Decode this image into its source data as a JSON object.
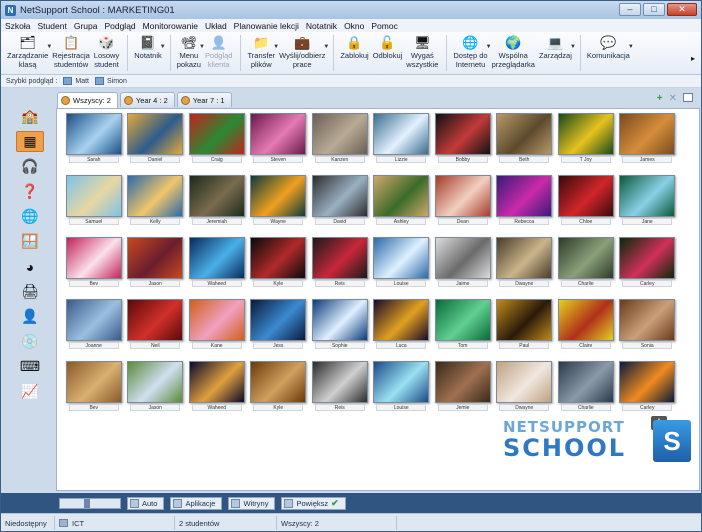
{
  "window": {
    "title": "NetSupport School : MARKETING01"
  },
  "menu": [
    "Szkoła",
    "Student",
    "Grupa",
    "Podgląd",
    "Monitorowanie",
    "Układ",
    "Planowanie lekcji",
    "Notatnik",
    "Okno",
    "Pomoc"
  ],
  "toolbar": [
    {
      "label": "Zarządzanie\nklasą",
      "icon": "class-management-icon",
      "glyph": "🗂",
      "disabled": false,
      "arrow": true
    },
    {
      "label": "Rejestracja\nstudentów",
      "icon": "register-icon",
      "glyph": "📋",
      "disabled": false,
      "arrow": false
    },
    {
      "label": "Losowy\nstudent",
      "icon": "dice-icon",
      "glyph": "🎲",
      "disabled": false,
      "arrow": false
    },
    {
      "label": "Notatnik",
      "icon": "notebook-icon",
      "glyph": "📓",
      "disabled": false,
      "arrow": true
    },
    {
      "label": "Menu\npokazu",
      "icon": "show-icon",
      "glyph": "📽",
      "disabled": false,
      "arrow": true
    },
    {
      "label": "Podgląd\nklienta",
      "icon": "view-client-icon",
      "glyph": "👤",
      "disabled": true,
      "arrow": false
    },
    {
      "label": "Transfer\nplików",
      "icon": "file-transfer-icon",
      "glyph": "📁",
      "disabled": false,
      "arrow": true
    },
    {
      "label": "Wyślij/odbierz\nprace",
      "icon": "briefcase-icon",
      "glyph": "💼",
      "disabled": false,
      "arrow": true
    },
    {
      "label": "Zablokuj",
      "icon": "lock-icon",
      "glyph": "🔒",
      "disabled": false,
      "arrow": false
    },
    {
      "label": "Odblokuj",
      "icon": "unlock-icon",
      "glyph": "🔓",
      "disabled": false,
      "arrow": false
    },
    {
      "label": "Wygaś\nwszystkie",
      "icon": "monitor-icon",
      "glyph": "🖥",
      "disabled": false,
      "arrow": false
    },
    {
      "label": "Dostęp do\nInternetu",
      "icon": "internet-icon",
      "glyph": "🌐",
      "disabled": false,
      "arrow": true
    },
    {
      "label": "Wspólna\nprzeglądarka",
      "icon": "globe-icon",
      "glyph": "🌍",
      "disabled": false,
      "arrow": false
    },
    {
      "label": "Zarządzaj",
      "icon": "manage-icon",
      "glyph": "💻",
      "disabled": false,
      "arrow": true
    },
    {
      "label": "Komunikacja",
      "icon": "chat-icon",
      "glyph": "💬",
      "disabled": false,
      "arrow": true
    }
  ],
  "quickview": {
    "label": "Szybki podgląd :",
    "items": [
      "Matt",
      "Simon"
    ]
  },
  "tabs": [
    {
      "label": "Wszyscy: 2",
      "active": true
    },
    {
      "label": "Year 4 : 2",
      "active": false
    },
    {
      "label": "Year 7 : 1",
      "active": false
    }
  ],
  "sidebar": [
    {
      "icon": "classroom-icon",
      "glyph": "🏫",
      "active": false
    },
    {
      "icon": "thumbnail-view-icon",
      "glyph": "▦",
      "active": true
    },
    {
      "icon": "headphones-icon",
      "glyph": "🎧",
      "active": false
    },
    {
      "icon": "question-icon",
      "glyph": "❓",
      "active": false
    },
    {
      "icon": "internet-icon",
      "glyph": "🌐",
      "active": false
    },
    {
      "icon": "applications-icon",
      "glyph": "🪟",
      "active": false
    },
    {
      "icon": "pie-chart-icon",
      "glyph": "◕",
      "active": false
    },
    {
      "icon": "printer-icon",
      "glyph": "🖨",
      "active": false
    },
    {
      "icon": "user-icon",
      "glyph": "👤",
      "active": false
    },
    {
      "icon": "cd-icon",
      "glyph": "💿",
      "active": false
    },
    {
      "icon": "keyboard-icon",
      "glyph": "⌨",
      "active": false
    },
    {
      "icon": "chart-icon",
      "glyph": "📈",
      "active": false
    }
  ],
  "students": [
    {
      "name": "Sarah",
      "c1": "#1b4f86",
      "c2": "#a8d2f0"
    },
    {
      "name": "Daniel",
      "c1": "#e3a83b",
      "c2": "#2d5b8c"
    },
    {
      "name": "Craig",
      "c1": "#c0241e",
      "c2": "#2a8a34"
    },
    {
      "name": "Steven",
      "c1": "#6a1a4a",
      "c2": "#e57ab5"
    },
    {
      "name": "Kanzen",
      "c1": "#6a6053",
      "c2": "#b8aa95"
    },
    {
      "name": "Lizzie",
      "c1": "#3a6d8f",
      "c2": "#e4f1ff"
    },
    {
      "name": "Bobby",
      "c1": "#111111",
      "c2": "#c33a3a"
    },
    {
      "name": "Beth",
      "c1": "#b89868",
      "c2": "#5c4a2d"
    },
    {
      "name": "T Joy",
      "c1": "#1a4a1a",
      "c2": "#e6c21f"
    },
    {
      "name": "James",
      "c1": "#7a4b1f",
      "c2": "#d68d3a"
    },
    {
      "name": "Samuel",
      "c1": "#7ec3e8",
      "c2": "#e8d7a2"
    },
    {
      "name": "Kelly",
      "c1": "#2b6aa8",
      "c2": "#f0c66b"
    },
    {
      "name": "Jeremiah",
      "c1": "#1d2a1d",
      "c2": "#7a6b4d"
    },
    {
      "name": "Wayne",
      "c1": "#0f3b3b",
      "c2": "#f0a020"
    },
    {
      "name": "David",
      "c1": "#2d2d2d",
      "c2": "#9ab0c2"
    },
    {
      "name": "Ashley",
      "c1": "#cfa86a",
      "c2": "#3a6b2a"
    },
    {
      "name": "Dean",
      "c1": "#a63a2a",
      "c2": "#f1d0c0"
    },
    {
      "name": "Rebecca",
      "c1": "#3a1a7a",
      "c2": "#c92aa8"
    },
    {
      "name": "Chloe",
      "c1": "#3a0a0a",
      "c2": "#d0252a"
    },
    {
      "name": "Jane",
      "c1": "#0a5a3a",
      "c2": "#8ad0e8"
    },
    {
      "name": "Bev",
      "c1": "#c2235a",
      "c2": "#fbe0ea"
    },
    {
      "name": "Jason",
      "c1": "#c9491e",
      "c2": "#6a1e2e"
    },
    {
      "name": "Waheed",
      "c1": "#0a2a5a",
      "c2": "#4ab0e8"
    },
    {
      "name": "Kyle",
      "c1": "#0a0a0a",
      "c2": "#b02a2a"
    },
    {
      "name": "Reis",
      "c1": "#1a1a1a",
      "c2": "#c8273a"
    },
    {
      "name": "Louise",
      "c1": "#2a6aa8",
      "c2": "#dff0ff"
    },
    {
      "name": "Jaime",
      "c1": "#dcdcdc",
      "c2": "#6a6a6a"
    },
    {
      "name": "Dwayne",
      "c1": "#4a3a2a",
      "c2": "#c9b58a"
    },
    {
      "name": "Charlie",
      "c1": "#2f3a2a",
      "c2": "#8aa07a"
    },
    {
      "name": "Carley",
      "c1": "#0a2a0a",
      "c2": "#d0305a"
    },
    {
      "name": "Joanne",
      "c1": "#3a5a8a",
      "c2": "#9ac0e0"
    },
    {
      "name": "Neil",
      "c1": "#5a0a0a",
      "c2": "#d0302a"
    },
    {
      "name": "Kane",
      "c1": "#d0601a",
      "c2": "#f0a0c0"
    },
    {
      "name": "Jess",
      "c1": "#0a1a3a",
      "c2": "#3a8ad0"
    },
    {
      "name": "Sophie",
      "c1": "#0a3a7a",
      "c2": "#e0f0ff"
    },
    {
      "name": "Luca",
      "c1": "#1a0a2a",
      "c2": "#e0a020"
    },
    {
      "name": "Tom",
      "c1": "#0a6a3a",
      "c2": "#60d090"
    },
    {
      "name": "Paul",
      "c1": "#c08a1a",
      "c2": "#2a1a0a"
    },
    {
      "name": "Claire",
      "c1": "#e0d020",
      "c2": "#b0301a"
    },
    {
      "name": "Sonia",
      "c1": "#6a3a1a",
      "c2": "#caa07a"
    },
    {
      "name": "Bev",
      "c1": "#8a5a2a",
      "c2": "#d8b070"
    },
    {
      "name": "Jason",
      "c1": "#5a8a3a",
      "c2": "#d0e0f0"
    },
    {
      "name": "Waheed",
      "c1": "#0a0a2a",
      "c2": "#e0a040"
    },
    {
      "name": "Kyle",
      "c1": "#6a3a0a",
      "c2": "#d0a060"
    },
    {
      "name": "Reis",
      "c1": "#2a2a2a",
      "c2": "#d0d0d0"
    },
    {
      "name": "Louise",
      "c1": "#1a4a8a",
      "c2": "#9ae0f0"
    },
    {
      "name": "Jemie",
      "c1": "#3a2a1a",
      "c2": "#a07050"
    },
    {
      "name": "Dwayne",
      "c1": "#c0a080",
      "c2": "#f0e8e0"
    },
    {
      "name": "Charlie",
      "c1": "#2a3a4a",
      "c2": "#8a9aa8"
    },
    {
      "name": "Carley",
      "c1": "#0a1a3a",
      "c2": "#f08a20"
    }
  ],
  "logo": {
    "line1": "NETSUPPORT",
    "line2": "SCHOOL",
    "mark": "S"
  },
  "bottombar": {
    "auto": "Auto",
    "apps": "Aplikacje",
    "sites": "Witryny",
    "zoom": "Powiększ"
  },
  "status": {
    "state": "Niedostępny",
    "room": "ICT",
    "students": "2 studentów",
    "all": "Wszyscy: 2"
  }
}
